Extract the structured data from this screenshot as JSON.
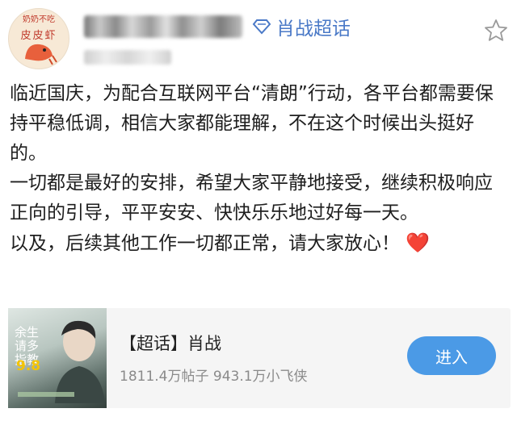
{
  "avatar": {
    "top_text": "奶奶不吃",
    "bottom_text": "皮皮虾"
  },
  "header": {
    "supertopic_label": "肖战超话"
  },
  "post": {
    "paragraphs": [
      "临近国庆，为配合互联网平台“清朗”行动，各平台都需要保持平稳低调，相信大家都能理解，不在这个时候出头挺好的。",
      "一切都是最好的安排，希望大家平静地接受，继续积极响应正向的引导，平平安安、快快乐乐地过好每一天。",
      "以及，后续其他工作一切都正常，请大家放心！"
    ],
    "emoji": "❤️"
  },
  "card": {
    "poster_title": "余生请多指教",
    "poster_date": "9.8",
    "title": "【超话】肖战",
    "stats": "1811.4万帖子 943.1万小飞侠",
    "enter_label": "进入"
  },
  "colors": {
    "link": "#4a79c7",
    "button": "#4b9ae6",
    "heart": "#e8433a"
  },
  "icons": [
    "supertopic-diamond-icon",
    "star-icon",
    "heart-emoji"
  ]
}
